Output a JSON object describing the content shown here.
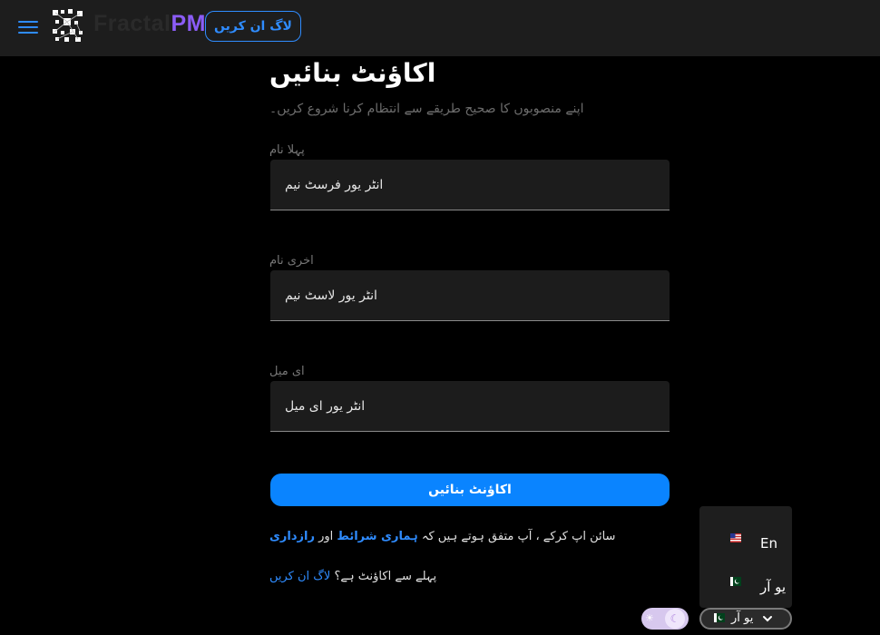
{
  "header": {
    "brand_part1": "Fractal",
    "brand_part2": "PM",
    "login_label": "لاگ ان کریں"
  },
  "form": {
    "title": "اکاؤنٹ بنائیں",
    "subtitle": "اپنے منصوبوں کا صحیح طریقے سے انتظام کرنا شروع کریں۔",
    "fields": [
      {
        "label": "پہلا نام",
        "placeholder": "انٹر یور فرسٹ نیم"
      },
      {
        "label": "اخری نام",
        "placeholder": "انٹر یور لاسٹ نیم"
      },
      {
        "label": "ای میل",
        "placeholder": "انٹر یور ای میل"
      }
    ],
    "submit_label": "اکاؤنٹ بنائیں",
    "terms_prefix": "سائن اپ کرکے ، آپ متفق ہوتے ہیں کہ",
    "terms_link": "ہماری شرائط",
    "terms_and": "اور",
    "privacy_link": "رازداری",
    "have_account_text": "پہلے سے اکاؤنٹ ہے؟",
    "login_link": "لاگ ان کریں"
  },
  "language_menu": {
    "items": [
      {
        "label": "En",
        "flag": "us-flag-icon"
      },
      {
        "label": "یو آر",
        "flag": "pk-flag-icon"
      }
    ]
  },
  "footer": {
    "language_selected": "یو آر"
  },
  "colors": {
    "accent": "#2f8cff",
    "button": "#0a84ff",
    "brand_pm": "#8b5cf6",
    "background": "#000000",
    "header_bg": "#1d1d1d",
    "field_bg": "#1c1c1c"
  }
}
